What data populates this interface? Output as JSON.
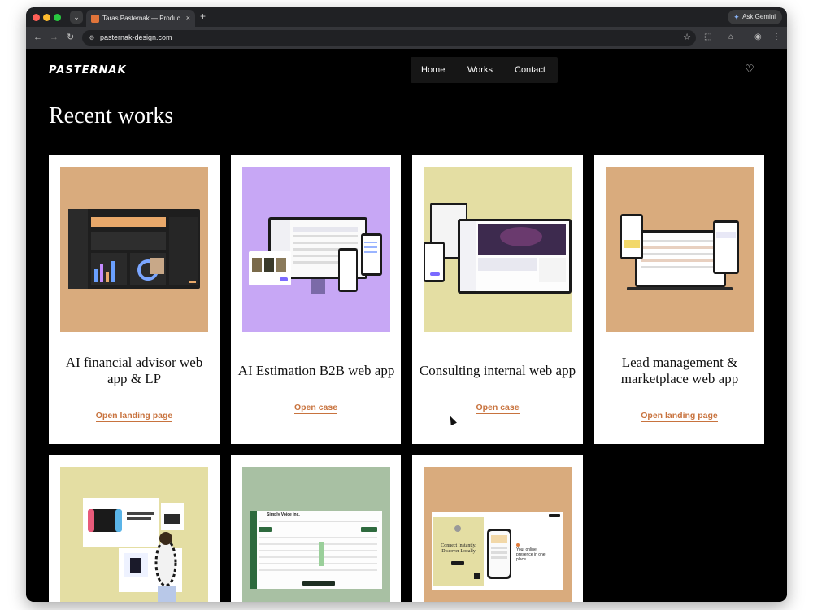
{
  "browser": {
    "tab_title": "Taras Pasternak — Product De",
    "tab_close": "×",
    "new_tab": "+",
    "ask_gemini": "Ask Gemini",
    "url": "pasternak-design.com"
  },
  "site": {
    "logo": "PASTERNAK",
    "nav": [
      "Home",
      "Works",
      "Contact"
    ],
    "heading": "Recent works"
  },
  "cards": [
    {
      "title": "AI financial advisor web app & LP",
      "link": "Open landing page",
      "bg": "#d9ab7d"
    },
    {
      "title": "AI Estimation B2B web app",
      "link": "Open case",
      "bg": "#c7a7f5"
    },
    {
      "title": "Consulting internal web app",
      "link": "Open case",
      "bg": "#e4dea3"
    },
    {
      "title": "Lead management & marketplace web app",
      "link": "Open landing page",
      "bg": "#d9ab7d"
    },
    {
      "title": "",
      "link": "",
      "bg": "#e4dea3"
    },
    {
      "title": "",
      "link": "",
      "bg": "#a8c0a3"
    },
    {
      "title": "",
      "link": "",
      "bg": "#d9ab7d"
    }
  ],
  "thumbnails": {
    "card7_caption": "Connect Instantly. Discover Locally",
    "card7_promo": "Your online presence in one place",
    "card6_app": "Simply Voice Inc."
  },
  "colors": {
    "link": "#c8733e",
    "page_bg": "#000000"
  }
}
